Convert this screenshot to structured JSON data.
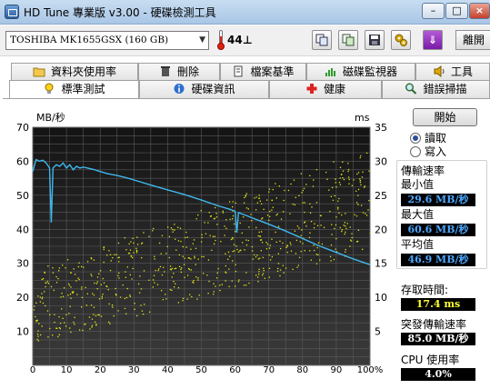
{
  "window": {
    "title": "HD Tune 專業版 v3.00 - 硬碟檢測工具",
    "minimize_label": "–",
    "maximize_label": "□",
    "close_label": "×"
  },
  "toolbar": {
    "drive": "TOSHIBA MK1655GSX (160 GB)",
    "temperature": "44",
    "temperature_unit": "⊥",
    "exit_label": "離開",
    "down_label": "⇓"
  },
  "tabs_top": [
    {
      "label": "資料夾使用率",
      "icon": "folder-icon"
    },
    {
      "label": "刪除",
      "icon": "trash-icon"
    },
    {
      "label": "檔案基準",
      "icon": "file-icon"
    },
    {
      "label": "磁碟監視器",
      "icon": "monitor-icon"
    },
    {
      "label": "工具",
      "icon": "speaker-icon"
    }
  ],
  "tabs_bottom": [
    {
      "label": "標準測試",
      "icon": "bulb-icon",
      "active": true
    },
    {
      "label": "硬碟資訊",
      "icon": "info-icon",
      "active": false
    },
    {
      "label": "健康",
      "icon": "health-cross-icon",
      "active": false
    },
    {
      "label": "錯誤掃描",
      "icon": "magnifier-icon",
      "active": false
    }
  ],
  "controls": {
    "start_label": "開始",
    "read_label": "讀取",
    "write_label": "寫入",
    "read_selected": true
  },
  "stats": {
    "transfer_rate_label": "傳輸速率",
    "min_label": "最小值",
    "min_value": "29.6 MB/秒",
    "max_label": "最大值",
    "max_value": "60.6 MB/秒",
    "avg_label": "平均值",
    "avg_value": "46.9 MB/秒",
    "access_label": "存取時間:",
    "access_value": "17.4 ms",
    "burst_label": "突發傳輸速率",
    "burst_value": "85.0 MB/秒",
    "cpu_label": "CPU 使用率",
    "cpu_value": "4.0%"
  },
  "colors": {
    "transfer_line": "#3fb8ee",
    "access_points": "#e6e61a",
    "plot_background": "#1e1e1e",
    "grid": "#5a5a5a"
  },
  "chart_data": {
    "type": "line",
    "ylabel_left": "MB/秒",
    "ylabel_right": "ms",
    "ylim_left": [
      0,
      70
    ],
    "ylim_right": [
      0,
      35
    ],
    "xlim": [
      0,
      100
    ],
    "left_ticks": [
      "70",
      "60",
      "50",
      "40",
      "30",
      "20",
      "10"
    ],
    "right_ticks": [
      "35",
      "30",
      "25",
      "20",
      "15",
      "10",
      "5"
    ],
    "x_ticks": [
      "0",
      "10",
      "20",
      "30",
      "40",
      "50",
      "60",
      "70",
      "80",
      "90",
      "100%"
    ],
    "grid": true,
    "series": [
      {
        "kind": "transfer_rate",
        "axis": "left",
        "x": [
          0,
          1,
          2,
          3,
          4,
          5,
          5.5,
          6,
          7,
          8,
          9,
          10,
          11,
          12,
          13,
          14,
          15,
          18,
          20,
          22,
          25,
          28,
          30,
          35,
          40,
          45,
          50,
          55,
          58,
          59,
          60,
          60.5,
          61,
          62,
          63,
          65,
          70,
          75,
          80,
          85,
          90,
          95,
          100
        ],
        "y": [
          57,
          60.5,
          60,
          60.3,
          59.5,
          58,
          42,
          58,
          59,
          58.5,
          59.5,
          58,
          59,
          57.5,
          58.5,
          58,
          58.3,
          57.6,
          57,
          56.4,
          55.8,
          55.1,
          54.5,
          53,
          51.6,
          50.2,
          48.6,
          46.9,
          46,
          45.7,
          45.3,
          39,
          44.9,
          44.5,
          44.2,
          43.4,
          41.5,
          39.5,
          37.3,
          35.1,
          33.2,
          31.3,
          29.6
        ]
      },
      {
        "kind": "access_time_scatter",
        "axis": "right",
        "note": "dense cloud of yellow points rising from about 3–14 ms near 0% to about 17–32 ms near 100%"
      }
    ]
  }
}
